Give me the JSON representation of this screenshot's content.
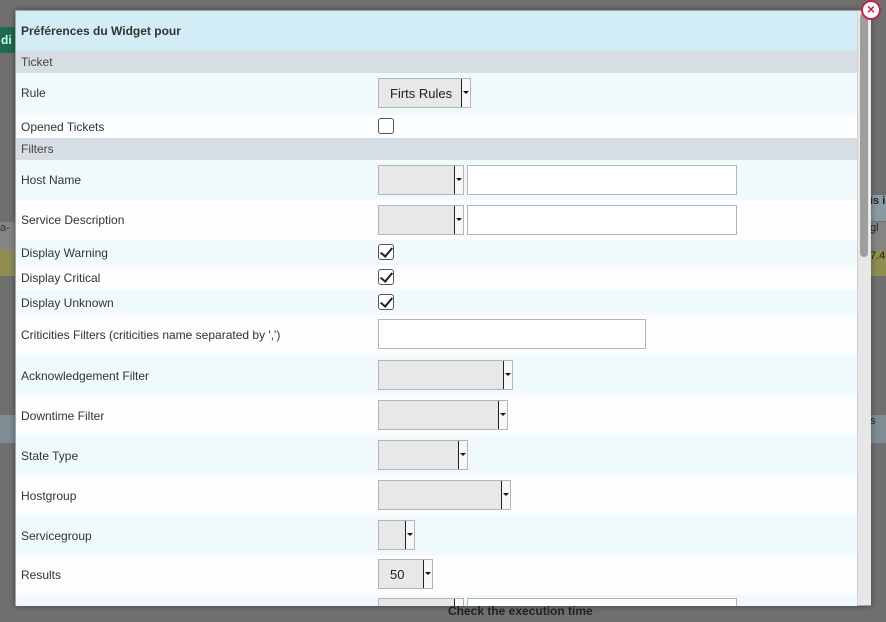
{
  "background": {
    "tab_fragment": "di",
    "right_fragment_head": "is i",
    "right_fragment_row1": "gl",
    "right_fragment_row2": "7.4",
    "right_fragment_row3": "s",
    "left_fragment_row1": "a-",
    "bottom_text": "Check the execution time"
  },
  "dialog": {
    "title": "Préférences du Widget pour",
    "close_glyph": "×",
    "sections": {
      "ticket": "Ticket",
      "filters": "Filters"
    },
    "fields": {
      "rule": {
        "label": "Rule",
        "value": "Firts Rules"
      },
      "opened_tickets": {
        "label": "Opened Tickets",
        "checked": false
      },
      "host_name": {
        "label": "Host Name",
        "select_value": "",
        "text_value": ""
      },
      "service_description": {
        "label": "Service Description",
        "select_value": "",
        "text_value": ""
      },
      "display_warning": {
        "label": "Display Warning",
        "checked": true
      },
      "display_critical": {
        "label": "Display Critical",
        "checked": true
      },
      "display_unknown": {
        "label": "Display Unknown",
        "checked": true
      },
      "criticities_filters": {
        "label": "Criticities Filters (criticities name separated by ',')",
        "value": ""
      },
      "acknowledgement_filter": {
        "label": "Acknowledgement Filter",
        "value": ""
      },
      "downtime_filter": {
        "label": "Downtime Filter",
        "value": ""
      },
      "state_type": {
        "label": "State Type",
        "value": ""
      },
      "hostgroup": {
        "label": "Hostgroup",
        "value": ""
      },
      "servicegroup": {
        "label": "Servicegroup",
        "value": ""
      },
      "results": {
        "label": "Results",
        "value": "50"
      }
    }
  },
  "colors": {
    "title_bar": "#d3edf7",
    "section_bar": "#d6dde3",
    "close_accent": "#c0264a"
  },
  "icons": {
    "close": "close-icon",
    "dropdown": "chevron-down-icon",
    "checkmark": "check-icon"
  }
}
